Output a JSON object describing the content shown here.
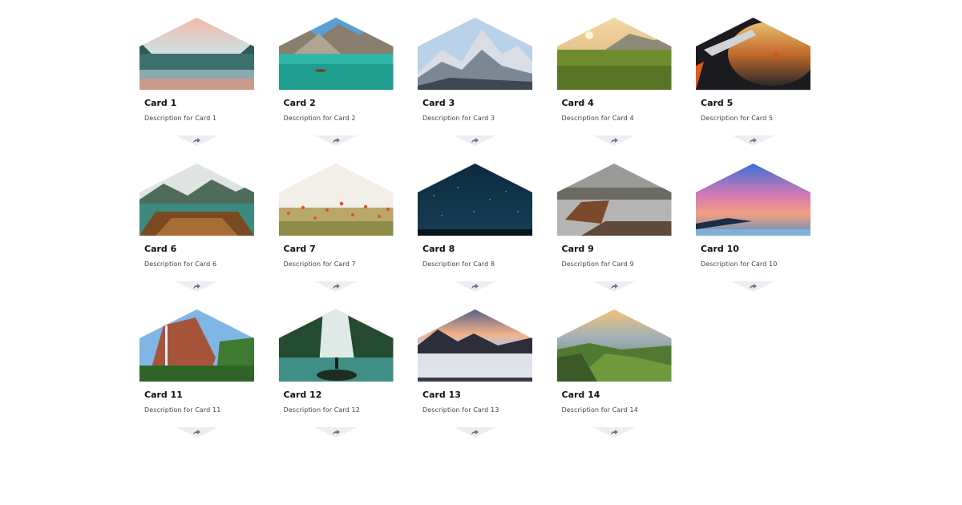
{
  "cards": [
    {
      "title": "Card 1",
      "description": "Description for Card 1",
      "share_icon": "share-icon",
      "image": "mountain-lake-forest-image"
    },
    {
      "title": "Card 2",
      "description": "Description for Card 2",
      "share_icon": "share-icon",
      "image": "turquoise-lake-boat-image"
    },
    {
      "title": "Card 3",
      "description": "Description for Card 3",
      "share_icon": "share-icon",
      "image": "snowy-mountains-image"
    },
    {
      "title": "Card 4",
      "description": "Description for Card 4",
      "share_icon": "share-icon",
      "image": "sunset-meadow-image"
    },
    {
      "title": "Card 5",
      "description": "Description for Card 5",
      "share_icon": "share-icon",
      "image": "airplane-wing-sunset-image"
    },
    {
      "title": "Card 6",
      "description": "Description for Card 6",
      "share_icon": "share-icon",
      "image": "wooden-boat-lake-image"
    },
    {
      "title": "Card 7",
      "description": "Description for Card 7",
      "share_icon": "share-icon",
      "image": "poppy-field-image"
    },
    {
      "title": "Card 8",
      "description": "Description for Card 8",
      "share_icon": "share-icon",
      "image": "starry-night-image"
    },
    {
      "title": "Card 9",
      "description": "Description for Card 9",
      "share_icon": "share-icon",
      "image": "rowboat-dock-image"
    },
    {
      "title": "Card 10",
      "description": "Description for Card 10",
      "share_icon": "share-icon",
      "image": "pink-sunset-coast-image"
    },
    {
      "title": "Card 11",
      "description": "Description for Card 11",
      "share_icon": "share-icon",
      "image": "cliff-waterfall-image"
    },
    {
      "title": "Card 12",
      "description": "Description for Card 12",
      "share_icon": "share-icon",
      "image": "forest-waterfall-image"
    },
    {
      "title": "Card 13",
      "description": "Description for Card 13",
      "share_icon": "share-icon",
      "image": "sea-of-clouds-image"
    },
    {
      "title": "Card 14",
      "description": "Description for Card 14",
      "share_icon": "share-icon",
      "image": "green-valley-image"
    }
  ]
}
